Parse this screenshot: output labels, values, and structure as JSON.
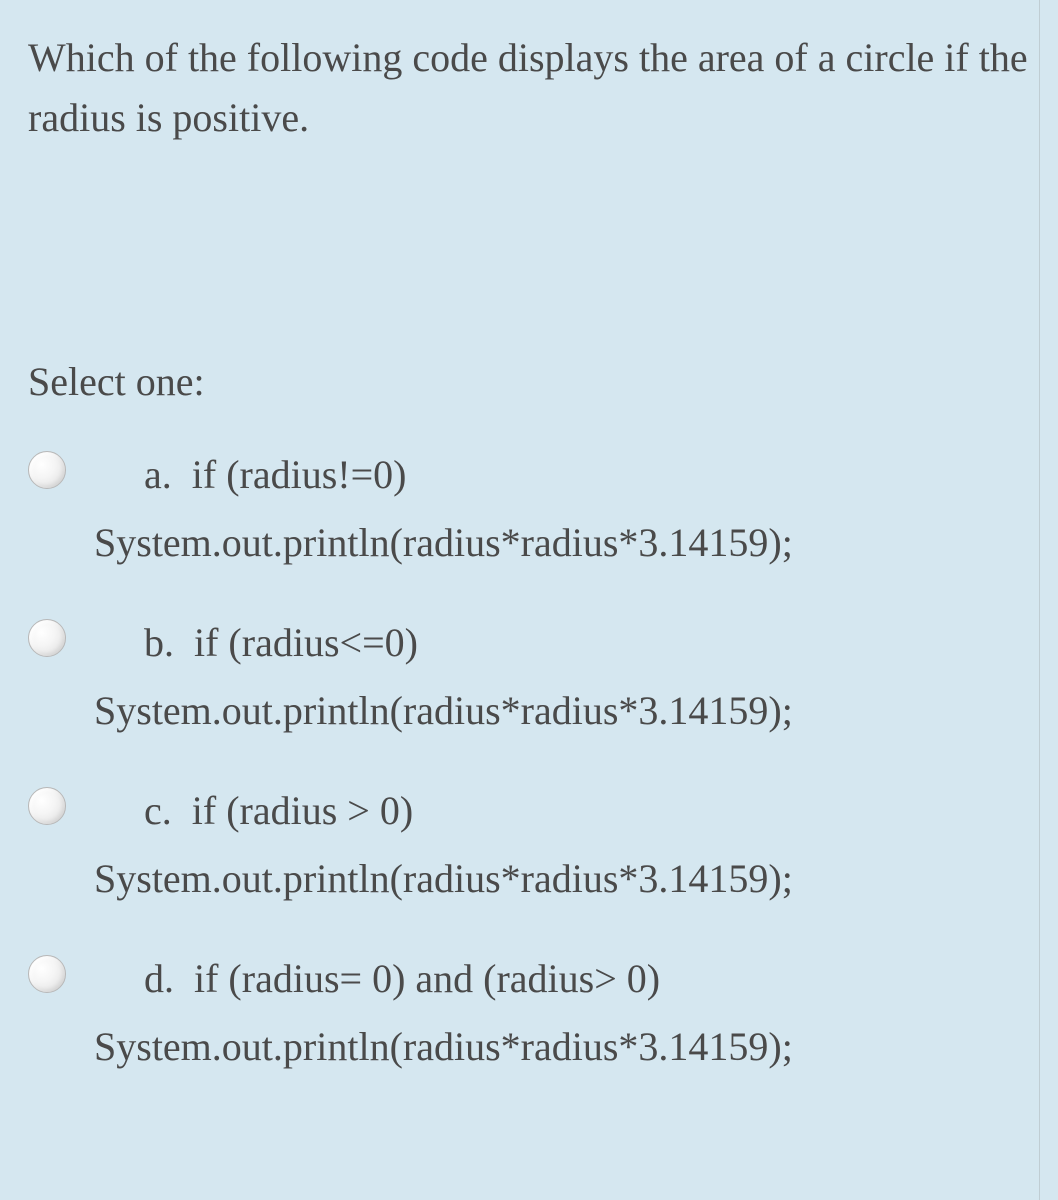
{
  "question": "Which of the following code displays the area of a circle if the radius is positive.",
  "select_label": "Select one:",
  "options": [
    {
      "letter": "a.",
      "line1": "if (radius!=0)",
      "line2": "System.out.println(radius*radius*3.14159);"
    },
    {
      "letter": "b.",
      "line1": "if (radius<=0)",
      "line2": "System.out.println(radius*radius*3.14159);"
    },
    {
      "letter": "c.",
      "line1": "if (radius > 0)",
      "line2": "System.out.println(radius*radius*3.14159);"
    },
    {
      "letter": "d.",
      "line1": "if (radius= 0) and (radius> 0)",
      "line2": "System.out.println(radius*radius*3.14159);"
    }
  ]
}
